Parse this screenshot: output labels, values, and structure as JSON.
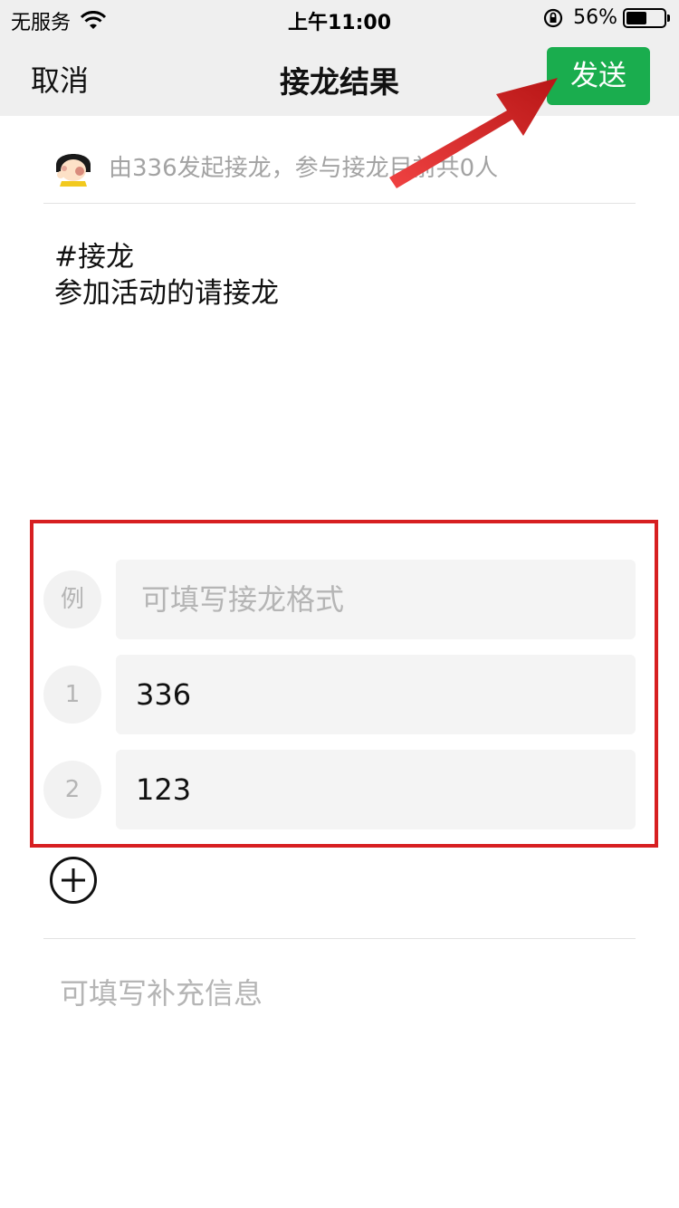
{
  "status_bar": {
    "carrier": "无服务",
    "time": "上午11:00",
    "battery": "56%",
    "battery_level": 0.56
  },
  "nav": {
    "cancel_label": "取消",
    "title": "接龙结果",
    "send_label": "发送"
  },
  "initiator": {
    "text": "由336发起接龙，参与接龙目前共0人"
  },
  "content": {
    "line1": "#接龙",
    "line2": "参加活动的请接龙"
  },
  "entries": [
    {
      "index": "例",
      "value": "",
      "placeholder": "可填写接龙格式"
    },
    {
      "index": "1",
      "value": "336"
    },
    {
      "index": "2",
      "value": "123"
    }
  ],
  "supplement_placeholder": "可填写补充信息",
  "colors": {
    "send_button": "#1aad4e",
    "highlight": "#d71f21"
  }
}
